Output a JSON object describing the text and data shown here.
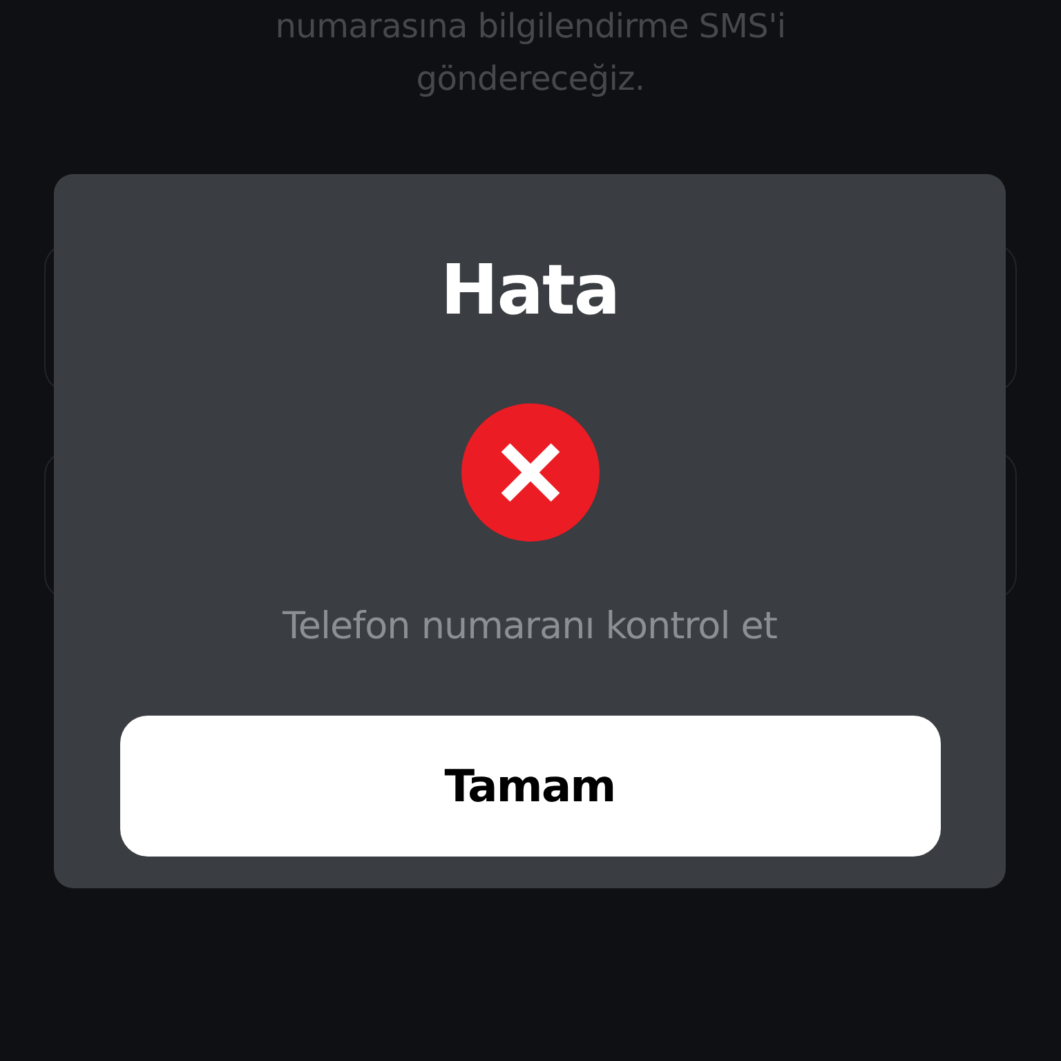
{
  "background_page": {
    "description": "numarasına bilgilendirme SMS'i göndereceğiz."
  },
  "dialog": {
    "title": "Hata",
    "message": "Telefon numaranı kontrol et",
    "buttons": [
      {
        "label": "Tamam"
      }
    ]
  }
}
